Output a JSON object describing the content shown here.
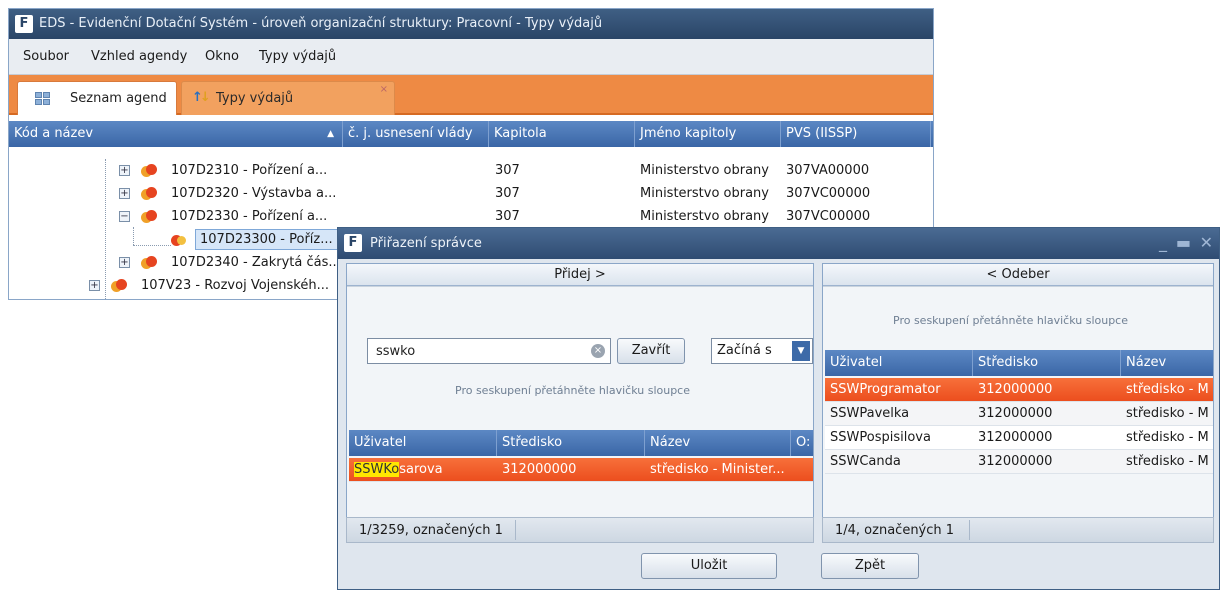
{
  "main_window": {
    "title": "EDS - Evidenční Dotační Systém - úroveň organizační struktury: Pracovní - Typy výdajů",
    "menu": [
      "Soubor",
      "Vzhled agendy",
      "Okno",
      "Typy výdajů"
    ],
    "tabs": [
      {
        "label": "Seznam agend",
        "active": true
      },
      {
        "label": "Typy výdajů",
        "active": false
      }
    ],
    "grid": {
      "columns": [
        "Kód a název",
        "č. j. usnesení vlády",
        "Kapitola",
        "Jméno kapitoly",
        "PVS (IISSP)"
      ],
      "rows": [
        {
          "name": "107D2310 -  Pořízení a...",
          "kapitola": "307",
          "jmeno": "Ministerstvo obrany",
          "pvs": "307VA00000",
          "expander": "+",
          "selected": false
        },
        {
          "name": "107D2320 -  Výstavba a...",
          "kapitola": "307",
          "jmeno": "Ministerstvo obrany",
          "pvs": "307VC00000",
          "expander": "+",
          "selected": false
        },
        {
          "name": "107D2330 -  Pořízení a...",
          "kapitola": "307",
          "jmeno": "Ministerstvo obrany",
          "pvs": "307VC00000",
          "expander": "−",
          "selected": false
        },
        {
          "name": "107D23300 -  Poříz...",
          "kapitola": "",
          "jmeno": "",
          "pvs": "",
          "expander": "",
          "selected": true
        },
        {
          "name": "107D2340 -  Zakrytá čás...",
          "kapitola": "",
          "jmeno": "",
          "pvs": "",
          "expander": "+",
          "selected": false
        },
        {
          "name": "107V23 -  Rozvoj Vojenskéh...",
          "kapitola": "",
          "jmeno": "",
          "pvs": "",
          "expander": "+",
          "selected": false
        }
      ]
    }
  },
  "dialog": {
    "title": "Přiřazení správce",
    "left": {
      "add_label": "Přidej  >",
      "search_value": "sswko",
      "close_label": "Zavřít",
      "filter_mode": "Začíná s",
      "group_hint": "Pro seskupení přetáhněte hlavičku sloupce",
      "columns": [
        "Uživatel",
        "Středisko",
        "Název",
        "O:"
      ],
      "rows": [
        {
          "match": "SSWKo",
          "rest": "sarova",
          "stredisko": "312000000",
          "nazev": "středisko - Minister..."
        }
      ],
      "status": "1/3259, označených 1"
    },
    "right": {
      "remove_label": "<  Odeber",
      "group_hint": "Pro seskupení přetáhněte hlavičku sloupce",
      "columns": [
        "Uživatel",
        "Středisko",
        "Název"
      ],
      "rows": [
        {
          "uzivatel": "SSWProgramator",
          "stredisko": "312000000",
          "nazev": "středisko - M"
        },
        {
          "uzivatel": "SSWPavelka",
          "stredisko": "312000000",
          "nazev": "středisko - M"
        },
        {
          "uzivatel": "SSWPospisilova",
          "stredisko": "312000000",
          "nazev": "středisko - M"
        },
        {
          "uzivatel": "SSWCanda",
          "stredisko": "312000000",
          "nazev": "středisko - M"
        }
      ],
      "status": "1/4, označených 1"
    },
    "save_label": "Uložit",
    "back_label": "Zpět"
  },
  "colors": {
    "accent_orange": "#ee8a44",
    "selection_orange": "#ec4e1e",
    "header_blue": "#3a66a6",
    "title_dark": "#2a4567",
    "highlight_yellow": "#ffe600"
  }
}
